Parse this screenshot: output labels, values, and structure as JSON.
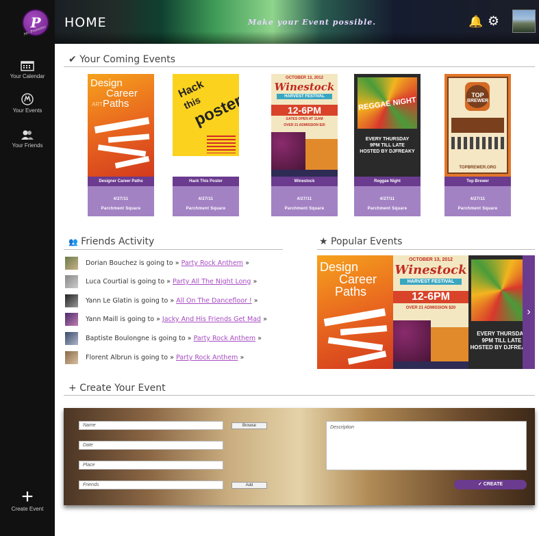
{
  "sidebar": {
    "logo_caption": "Mr. Promoter",
    "items": [
      {
        "label": "Your Calendar"
      },
      {
        "label": "Your Events"
      },
      {
        "label": "Your Friends"
      },
      {
        "label": "Create Event"
      }
    ]
  },
  "header": {
    "title": "HOME",
    "tagline": "Make your Event possible."
  },
  "coming": {
    "title": "Your Coming Events",
    "events": [
      {
        "name": "Designer Career Paths",
        "date": "4/27/11",
        "place": "Parchment Square"
      },
      {
        "name": "Hack This Poster",
        "date": "4/27/11",
        "place": "Parchment Square"
      },
      {
        "name": "Winestock",
        "date": "4/27/11",
        "place": "Parchment Square"
      },
      {
        "name": "Reggae Night",
        "date": "4/27/11",
        "place": "Parchment Square"
      },
      {
        "name": "Top Brewer",
        "date": "4/27/11",
        "place": "Parchment Square"
      }
    ]
  },
  "friends": {
    "title": "Friends Activity",
    "going_text": "is going to",
    "items": [
      {
        "name": "Dorian Bouchez",
        "event": "Party Rock Anthem"
      },
      {
        "name": "Luca Courtial",
        "event": "Party All The Night Long"
      },
      {
        "name": "Yann Le Glatin",
        "event": "All On The Dancefloor !"
      },
      {
        "name": "Yann Maill",
        "event": "Jacky And His Friends Get Mad"
      },
      {
        "name": "Baptiste Boulongne",
        "event": "Party Rock Anthem"
      },
      {
        "name": "Florent Albrun",
        "event": "Party Rock Anthem"
      }
    ]
  },
  "popular": {
    "title": "Popular Events"
  },
  "create": {
    "title": "Create Your Event",
    "name_placeholder": "Name",
    "date_placeholder": "Date",
    "place_placeholder": "Place",
    "friends_placeholder": "Friends",
    "description_placeholder": "Description",
    "browse_label": "Browse",
    "add_label": "Add",
    "create_label": "✓ CREATE"
  },
  "posters": {
    "design": [
      "Design",
      "Career",
      "Paths",
      "ART"
    ],
    "hack": [
      "Hack",
      "this",
      "poster"
    ],
    "wine": [
      "OCTOBER 13, 2012",
      "Winestock",
      "HARVEST FESTIVAL",
      "12-6PM",
      "GATES OPEN AT 11AM",
      "OVER 21 ADMISSION $20"
    ],
    "reggae": [
      "REGGAE NIGHT",
      "EVERY THURSDAY",
      "9PM TILL LATE",
      "HOSTED BY DJFREAKY"
    ],
    "brewer": [
      "TOP",
      "BREWER",
      "TOPBREWER.ORG"
    ]
  },
  "colors": {
    "accent": "#a64bc2",
    "card_bar": "#6a3b8f",
    "card_info": "#a382c4"
  }
}
